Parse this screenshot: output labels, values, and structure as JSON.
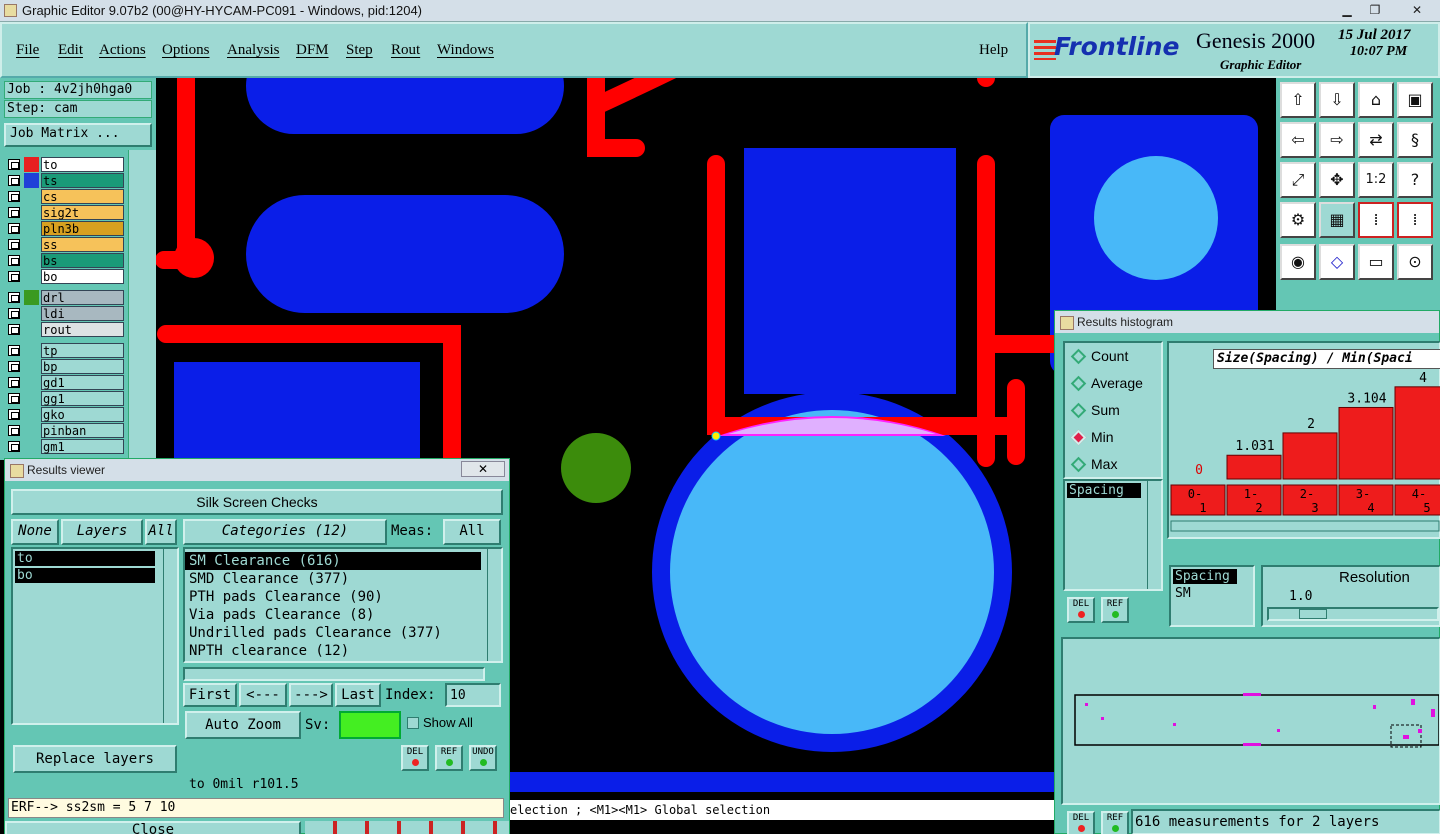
{
  "window": {
    "title": "Graphic Editor 9.07b2 (00@HY-HYCAM-PC091 - Windows, pid:1204)"
  },
  "menu": {
    "items": [
      "File",
      "Edit",
      "Actions",
      "Options",
      "Analysis",
      "DFM",
      "Step",
      "Rout",
      "Windows"
    ],
    "help": "Help"
  },
  "brand": {
    "logo": "Frontline",
    "product": "Genesis 2000",
    "subtitle": "Graphic Editor",
    "date": "15 Jul 2017",
    "time": "10:07 PM"
  },
  "job": {
    "job_label": "Job : 4v2jh0hga0",
    "step_label": "Step: cam",
    "matrix_button": "Job Matrix ..."
  },
  "layers": [
    {
      "name": "to",
      "bg": "#ffffff",
      "swatch": "#e82020"
    },
    {
      "name": "ts",
      "bg": "#1a9a78",
      "swatch": "#2040d8"
    },
    {
      "name": "cs",
      "bg": "#f6c25a",
      "swatch": ""
    },
    {
      "name": "sig2t",
      "bg": "#f6c25a",
      "swatch": ""
    },
    {
      "name": "pln3b",
      "bg": "#d8a020",
      "swatch": ""
    },
    {
      "name": "ss",
      "bg": "#f6c25a",
      "swatch": ""
    },
    {
      "name": "bs",
      "bg": "#1a9a78",
      "swatch": ""
    },
    {
      "name": "bo",
      "bg": "#ffffff",
      "swatch": ""
    },
    {
      "name": "drl",
      "bg": "#a8b8c0",
      "swatch": "#3a9a20"
    },
    {
      "name": "ldi",
      "bg": "#a8b8c0",
      "swatch": ""
    },
    {
      "name": "rout",
      "bg": "#dde2e4",
      "swatch": ""
    },
    {
      "name": "tp",
      "bg": "#9ed9d3",
      "swatch": ""
    },
    {
      "name": "bp",
      "bg": "#9ed9d3",
      "swatch": ""
    },
    {
      "name": "gd1",
      "bg": "#9ed9d3",
      "swatch": ""
    },
    {
      "name": "gg1",
      "bg": "#9ed9d3",
      "swatch": ""
    },
    {
      "name": "gko",
      "bg": "#9ed9d3",
      "swatch": ""
    },
    {
      "name": "pinban",
      "bg": "#9ed9d3",
      "swatch": ""
    },
    {
      "name": "gm1",
      "bg": "#9ed9d3",
      "swatch": ""
    }
  ],
  "results_viewer": {
    "title": "Results viewer",
    "check_name": "Silk Screen Checks",
    "none_label": "None",
    "layers_label": "Layers",
    "all_label": "All",
    "selected_layers": [
      "to",
      "bo"
    ],
    "categories_label": "Categories (12)",
    "meas_label": "Meas:",
    "meas_value": "All",
    "categories": [
      "SM Clearance (616)",
      "SMD Clearance (377)",
      "PTH pads Clearance (90)",
      "Via pads Clearance (8)",
      "Undrilled pads Clearance (377)",
      "NPTH clearance (12)"
    ],
    "nav": {
      "first": "First",
      "prev": "<---",
      "next": "--->",
      "last": "Last",
      "index_label": "Index:",
      "index_value": "10"
    },
    "auto_zoom": "Auto Zoom",
    "sv_label": "Sv:",
    "show_all": "Show All",
    "replace_layers": "Replace layers",
    "del": "DEL",
    "ref": "REF",
    "undo": "UNDO",
    "status": "to 0mil  r101.5",
    "close": "Close"
  },
  "command_line": "ERF--> ss2sm = 5 7 10",
  "status_hint": "election ; <M1><M1> Global selection",
  "histogram": {
    "title": "Results histogram",
    "modes": [
      "Count",
      "Average",
      "Sum",
      "Min",
      "Max"
    ],
    "selected_mode": "Min",
    "field_list": [
      "Spacing"
    ],
    "header": "Size(Spacing) / Min(Spaci",
    "resolution_label": "Resolution",
    "resolution_value": "1.0",
    "types": [
      "Spacing",
      "SM"
    ],
    "del": "DEL",
    "ref": "REF",
    "footer": "616 measurements for 2 layers"
  },
  "chart_data": {
    "type": "bar",
    "title": "Size(Spacing) / Min(Spaci",
    "categories": [
      "0-1",
      "1-2",
      "2-3",
      "3-4",
      "4-5"
    ],
    "values": [
      0,
      1.031,
      2,
      3.104,
      4
    ],
    "value_labels": [
      "0",
      "1.031",
      "2",
      "3.104",
      "4"
    ],
    "ylim": [
      0,
      4.6
    ],
    "color": "#ee1c1c"
  },
  "colors": {
    "panel": "#64c6b4",
    "panel_light": "#9ed9d3",
    "red": "#ff0000",
    "blue": "#0a1ee8",
    "light_blue": "#48b8f8",
    "green": "#3c8c0c",
    "magenta": "#ff22ff"
  }
}
